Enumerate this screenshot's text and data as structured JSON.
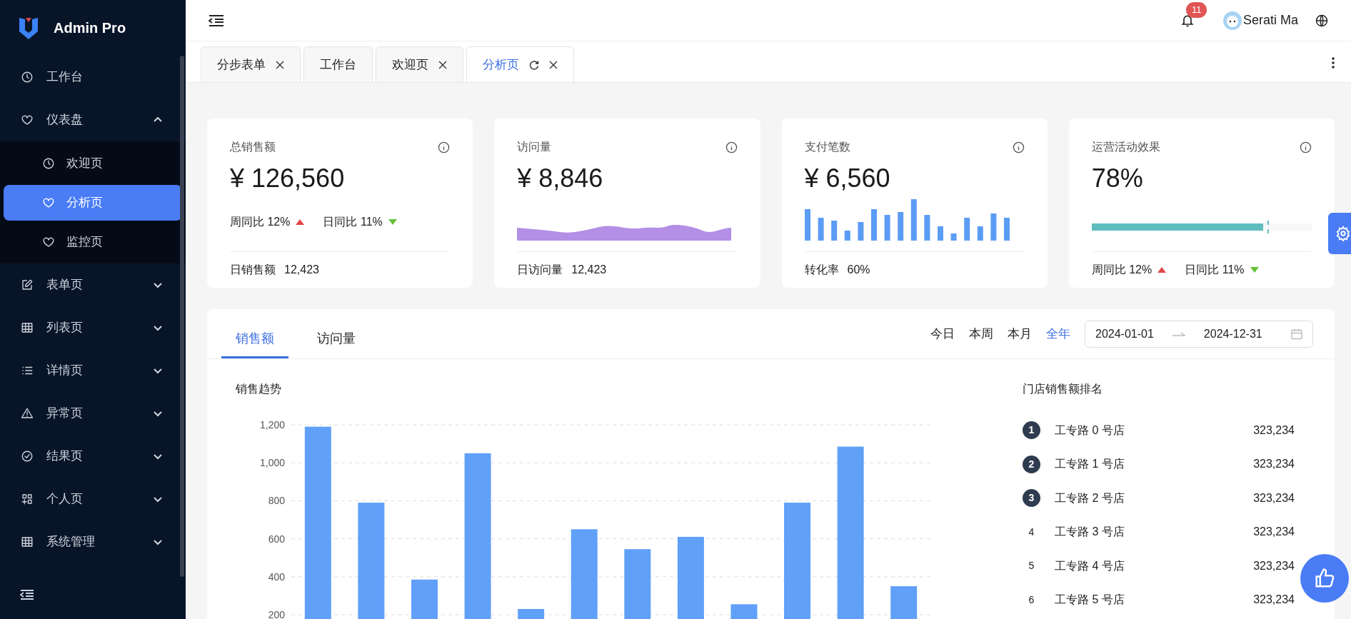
{
  "sidebar": {
    "brand": "Admin Pro",
    "items": [
      {
        "kind": "link",
        "label": "工作台",
        "selected": false
      },
      {
        "kind": "group",
        "label": "仪表盘",
        "selected": false,
        "expanded": true,
        "children": [
          {
            "label": "欢迎页",
            "selected": false
          },
          {
            "label": "分析页",
            "selected": true
          },
          {
            "label": "监控页",
            "selected": false
          }
        ]
      },
      {
        "kind": "group",
        "label": "表单页",
        "selected": false,
        "expanded": false
      },
      {
        "kind": "group",
        "label": "列表页",
        "selected": false,
        "expanded": false
      },
      {
        "kind": "group",
        "label": "详情页",
        "selected": false,
        "expanded": false
      },
      {
        "kind": "group",
        "label": "异常页",
        "selected": false,
        "expanded": false
      },
      {
        "kind": "group",
        "label": "结果页",
        "selected": false,
        "expanded": false
      },
      {
        "kind": "group",
        "label": "个人页",
        "selected": false,
        "expanded": false
      },
      {
        "kind": "group",
        "label": "系统管理",
        "selected": false,
        "expanded": false
      }
    ]
  },
  "header": {
    "notification_count": "11",
    "user_name": "Serati Ma"
  },
  "tabs": [
    {
      "label": "分步表单",
      "selected": false,
      "closable": true
    },
    {
      "label": "工作台",
      "selected": false,
      "closable": false
    },
    {
      "label": "欢迎页",
      "selected": false,
      "closable": true
    },
    {
      "label": "分析页",
      "selected": true,
      "closable": true
    }
  ],
  "stat_cards": [
    {
      "kind": "trend",
      "title": "总销售额",
      "value": "¥ 126,560",
      "trends": [
        {
          "label": "周同比 12%",
          "kind": "up"
        },
        {
          "label": "日同比 11%",
          "kind": "down"
        }
      ],
      "footer_label": "日销售额",
      "footer_value": "12,423"
    },
    {
      "kind": "area",
      "title": "访问量",
      "value": "¥ 8,846",
      "footer_label": "日访问量",
      "footer_value": "12,423"
    },
    {
      "kind": "bars",
      "title": "支付笔数",
      "value": "¥ 6,560",
      "footer_label": "转化率",
      "footer_value": "60%"
    },
    {
      "kind": "progress",
      "title": "运营活动效果",
      "value": "78%",
      "level": 0.78,
      "trends": [
        {
          "label": "周同比 12%",
          "kind": "up"
        },
        {
          "label": "日同比 11%",
          "kind": "down"
        }
      ]
    }
  ],
  "sales_panel": {
    "tabs": [
      {
        "label": "销售额",
        "selected": true
      },
      {
        "label": "访问量",
        "selected": false
      }
    ],
    "ranges": [
      {
        "label": "今日",
        "selected": false
      },
      {
        "label": "本周",
        "selected": false
      },
      {
        "label": "本月",
        "selected": false
      },
      {
        "label": "全年",
        "selected": true
      }
    ],
    "date_start": "2024-01-01",
    "date_end": "2024-12-31",
    "chart_data": {
      "type": "bar",
      "title": "销售趋势",
      "ylim": [
        0,
        1200
      ],
      "grid": true,
      "yticks": [
        {
          "value": 200,
          "label": "200"
        },
        {
          "value": 400,
          "label": "400"
        },
        {
          "value": 600,
          "label": "600"
        },
        {
          "value": 800,
          "label": "800"
        },
        {
          "value": 1000,
          "label": "1,000"
        },
        {
          "value": 1200,
          "label": "1,200"
        }
      ],
      "values": [
        1190,
        790,
        385,
        1050,
        230,
        650,
        545,
        610,
        255,
        790,
        1085,
        350
      ]
    },
    "ranking": {
      "title": "门店销售额排名",
      "rows": [
        {
          "rank": "1",
          "name": "工专路 0 号店",
          "value": "323,234",
          "highlighted": true
        },
        {
          "rank": "2",
          "name": "工专路 1 号店",
          "value": "323,234",
          "highlighted": true
        },
        {
          "rank": "3",
          "name": "工专路 2 号店",
          "value": "323,234",
          "highlighted": true
        },
        {
          "rank": "4",
          "name": "工专路 3 号店",
          "value": "323,234",
          "highlighted": false
        },
        {
          "rank": "5",
          "name": "工专路 4 号店",
          "value": "323,234",
          "highlighted": false
        },
        {
          "rank": "6",
          "name": "工专路 5 号店",
          "value": "323,234",
          "highlighted": false
        }
      ]
    }
  }
}
